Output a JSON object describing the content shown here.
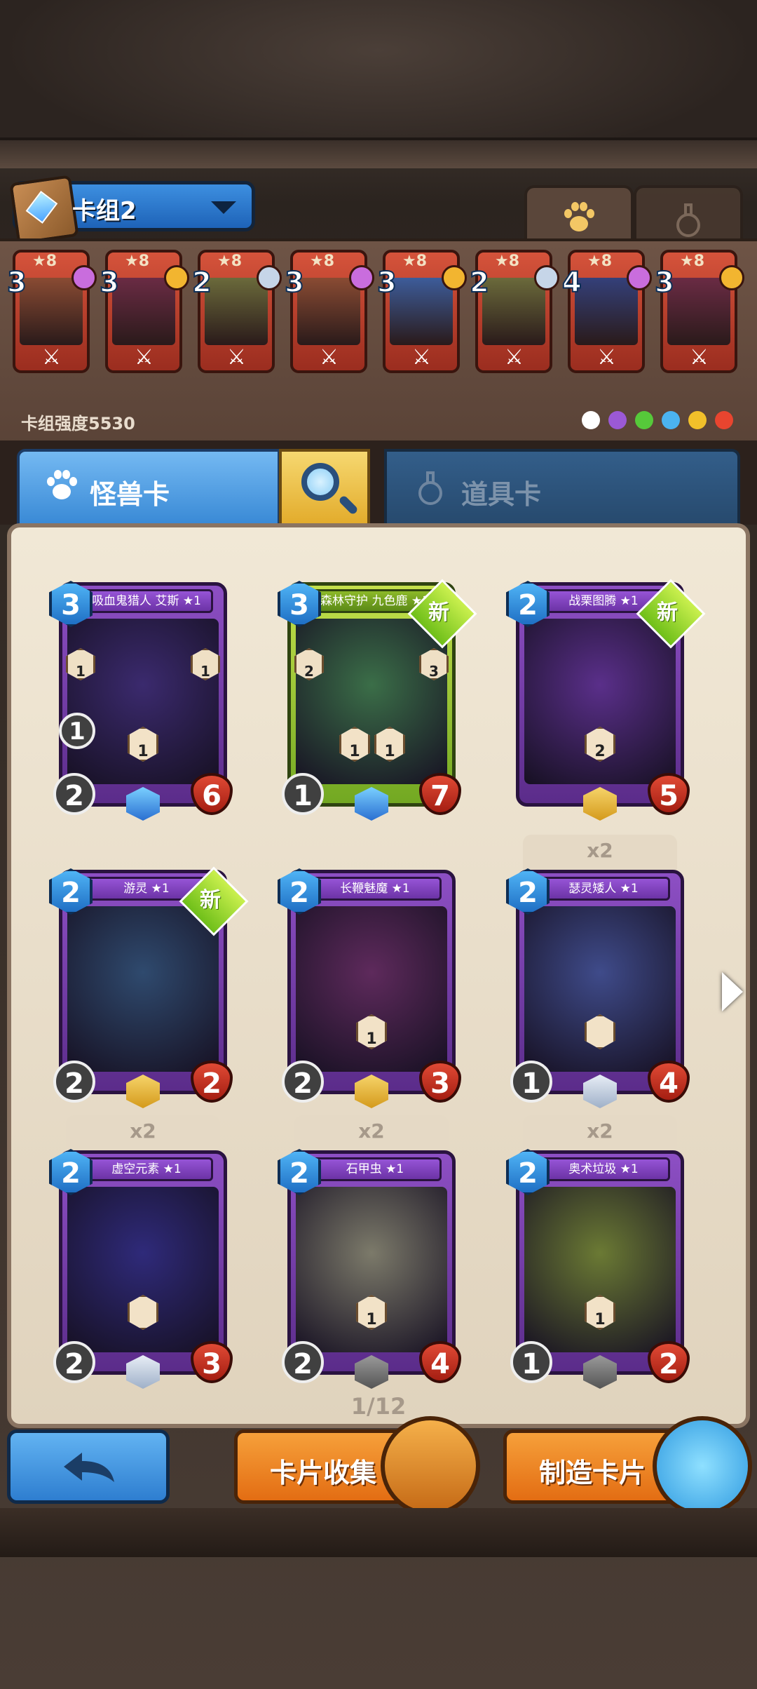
{
  "deck": {
    "name": "卡组2",
    "power_label": "卡组强度5530"
  },
  "top_tabs": {
    "monster_icon": "paw-icon",
    "item_icon": "flask-icon"
  },
  "deck_cards": [
    {
      "star": "★8",
      "cost": "3",
      "gem": "#c96ddd",
      "art": "#8a4b33"
    },
    {
      "star": "★8",
      "cost": "3",
      "gem": "#f2b530",
      "art": "#6a2b44"
    },
    {
      "star": "★8",
      "cost": "2",
      "gem": "#c6d5e8",
      "art": "#6b6a3b"
    },
    {
      "star": "★8",
      "cost": "3",
      "gem": "#c96ddd",
      "art": "#8a4b33"
    },
    {
      "star": "★8",
      "cost": "3",
      "gem": "#f2b530",
      "art": "#3d5c9a"
    },
    {
      "star": "★8",
      "cost": "2",
      "gem": "#c6d5e8",
      "art": "#6b6a3b"
    },
    {
      "star": "★8",
      "cost": "4",
      "gem": "#c96ddd",
      "art": "#34407a"
    },
    {
      "star": "★8",
      "cost": "3",
      "gem": "#f2b530",
      "art": "#6a2b44"
    }
  ],
  "filter_dots": [
    "#ffffff",
    "#9b59d6",
    "#56c93a",
    "#4bb3f0",
    "#f2c02a",
    "#e8452f"
  ],
  "tabs": {
    "monster": "怪兽卡",
    "item": "道具卡"
  },
  "cards": [
    {
      "name": "吸血鬼猎人 艾斯 ★1",
      "cost": "3",
      "atk": "2",
      "hp": "6",
      "count": "",
      "new": false,
      "theme": "purple",
      "art": "#3b2a6e",
      "left_stat": "1",
      "right_stat": "1",
      "mid": [
        "1"
      ],
      "mid2": ""
    },
    {
      "name": "森林守护 九色鹿 ★1",
      "cost": "3",
      "atk": "1",
      "hp": "7",
      "count": "",
      "new": true,
      "theme": "green",
      "art": "#3b6e48",
      "left_stat": "2",
      "right_stat": "3",
      "mid": [
        "1",
        "1"
      ],
      "mid2": ""
    },
    {
      "name": "战栗图腾 ★1",
      "cost": "2",
      "atk": "",
      "hp": "5",
      "count": "",
      "new": true,
      "theme": "purple",
      "art": "#5a2f8a",
      "left_stat": "",
      "right_stat": "",
      "mid": [
        "2"
      ],
      "mid2": ""
    },
    {
      "name": "游灵 ★1",
      "cost": "2",
      "atk": "2",
      "hp": "2",
      "count": "",
      "new": true,
      "theme": "purple",
      "art": "#2f4a6e",
      "left_stat": "",
      "right_stat": "",
      "mid": [],
      "mid2": ""
    },
    {
      "name": "长鞭魅魔 ★1",
      "cost": "2",
      "atk": "2",
      "hp": "3",
      "count": "",
      "new": false,
      "theme": "purple",
      "art": "#5e2a5c",
      "left_stat": "",
      "right_stat": "",
      "mid": [
        "1"
      ],
      "mid2": ""
    },
    {
      "name": "瑟灵矮人 ★1",
      "cost": "2",
      "atk": "1",
      "hp": "4",
      "count": "x2",
      "new": false,
      "theme": "purple",
      "art": "#3f4b8a",
      "left_stat": "",
      "right_stat": "",
      "mid": [
        ""
      ],
      "mid2": ""
    },
    {
      "name": "虚空元素 ★1",
      "cost": "2",
      "atk": "2",
      "hp": "3",
      "count": "x2",
      "new": false,
      "theme": "purple",
      "art": "#2f2a7a",
      "left_stat": "",
      "right_stat": "",
      "mid": [
        ""
      ],
      "mid2": ""
    },
    {
      "name": "石甲虫 ★1",
      "cost": "2",
      "atk": "2",
      "hp": "4",
      "count": "x2",
      "new": false,
      "theme": "purple",
      "art": "#7c7a6a",
      "left_stat": "",
      "right_stat": "",
      "mid": [
        "1"
      ],
      "mid2": ""
    },
    {
      "name": "奥术垃圾 ★1",
      "cost": "2",
      "atk": "1",
      "hp": "2",
      "count": "x2",
      "new": false,
      "theme": "purple",
      "art": "#6b7a34",
      "left_stat": "",
      "right_stat": "",
      "mid": [
        "1"
      ],
      "mid2": ""
    }
  ],
  "new_label": "新",
  "page": "1/12",
  "buttons": {
    "collect": "卡片收集",
    "craft": "制造卡片"
  }
}
